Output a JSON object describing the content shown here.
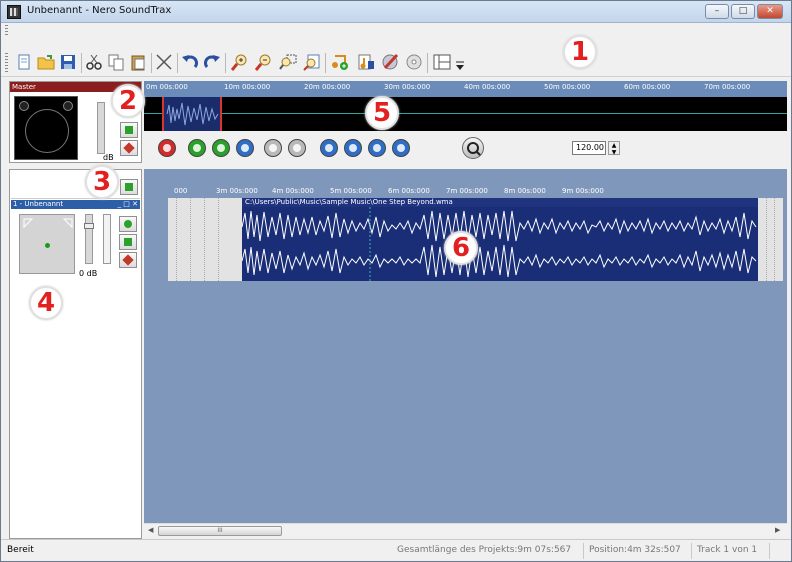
{
  "window": {
    "title": "Unbenannt - Nero SoundTrax",
    "controls": [
      "minimize",
      "maximize",
      "close"
    ]
  },
  "toolbar": {
    "icons": [
      "new-document-icon",
      "open-folder-icon",
      "save-icon",
      "cut-icon",
      "copy-icon",
      "paste-icon",
      "delete-icon",
      "undo-icon",
      "redo-icon",
      "zoom-in-icon",
      "zoom-out-icon",
      "zoom-selection-icon",
      "zoom-fit-icon",
      "add-audio-icon",
      "music-note-icon",
      "burn-icon",
      "cd-icon",
      "layout-icon",
      "dropdown-icon"
    ]
  },
  "callouts": [
    "1",
    "2",
    "3",
    "4",
    "5",
    "6"
  ],
  "master": {
    "label": "Master",
    "db": "dB"
  },
  "overview_ruler": {
    "ticks": [
      "0m 00s:000",
      "10m 00s:000",
      "20m 00s:000",
      "30m 00s:000",
      "40m 00s:000",
      "50m 00s:000",
      "60m 00s:000",
      "70m 00s:000"
    ]
  },
  "transport": {
    "buttons": [
      "record-icon",
      "play-icon",
      "play-from-cursor-icon",
      "loop-icon",
      "pause-icon",
      "stop-icon",
      "go-to-start-icon",
      "rewind-icon",
      "fast-forward-icon",
      "go-to-end-icon"
    ],
    "bpm_value": "120.00"
  },
  "track": {
    "name": "1 - Unbenannt",
    "window_controls": "_ □ ✕",
    "db": "0 dB"
  },
  "edit_ruler": {
    "ticks": [
      "000",
      "3m 00s:000",
      "4m 00s:000",
      "5m 00s:000",
      "6m 00s:000",
      "7m 00s:000",
      "8m 00s:000",
      "9m 00s:000"
    ]
  },
  "clip": {
    "path": "C:\\Users\\Public\\Music\\Sample Music\\One Step Beyond.wma"
  },
  "scrollbar": {
    "thumb_grip": "III"
  },
  "status": {
    "ready": "Bereit",
    "total_length": "Gesamtlänge des Projekts:9m 07s:567",
    "position": "Position:4m 32s:507",
    "track": "Track 1 von 1"
  },
  "colors": {
    "accent_callout": "#e32020",
    "waveform_bg": "#1a2e78",
    "edit_bg": "#7f97bb",
    "master_head": "#8a1d1d"
  }
}
